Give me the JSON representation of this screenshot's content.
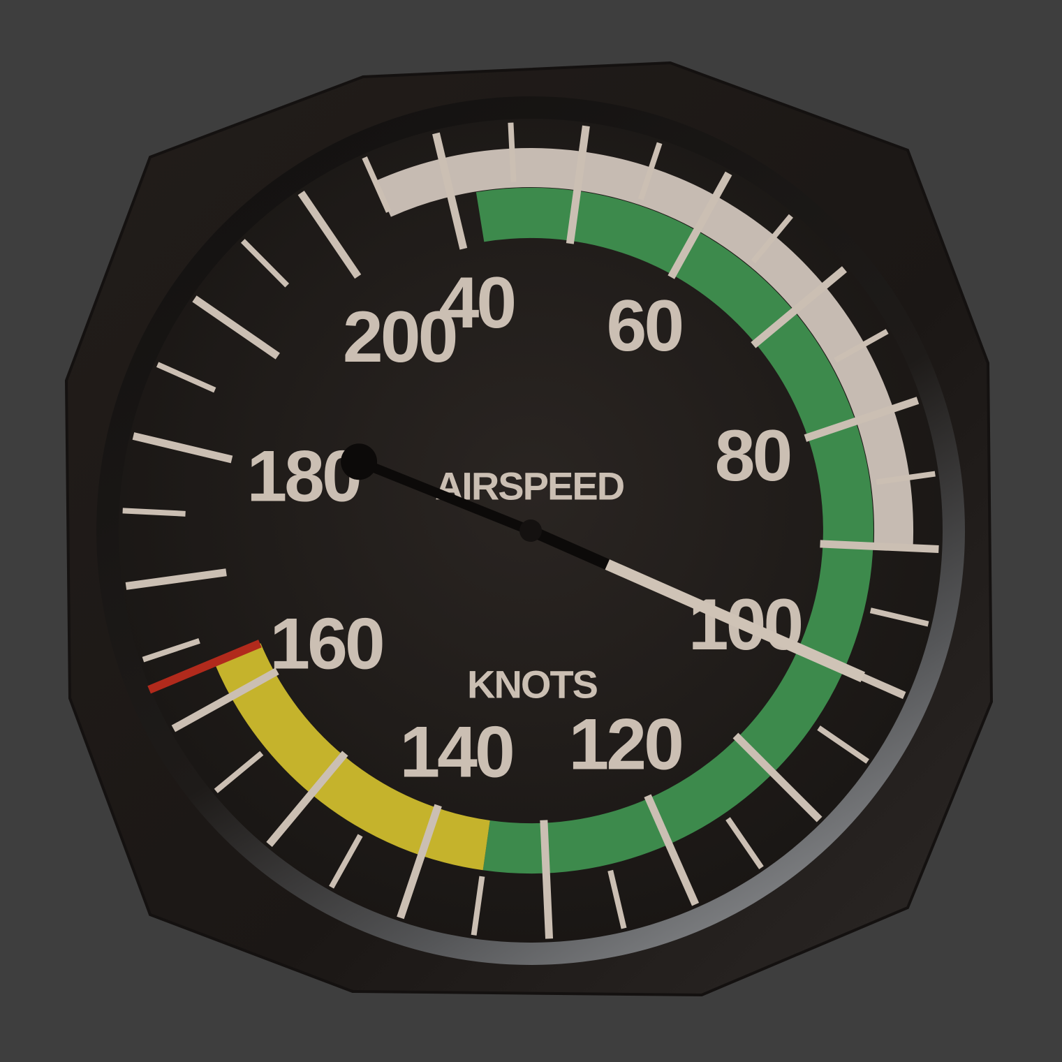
{
  "instrument": {
    "type": "airspeed-indicator",
    "title": "AIRSPEED",
    "unit": "KNOTS",
    "needle_value_knots": 100,
    "scale": {
      "labels": [
        "40",
        "60",
        "80",
        "100",
        "120",
        "140",
        "160",
        "180",
        "200"
      ],
      "label_values": [
        40,
        60,
        80,
        100,
        120,
        140,
        160,
        180,
        200
      ],
      "minor_tick_step_knots": 5
    },
    "arcs": [
      {
        "name": "white-arc",
        "from": 35,
        "to": 90,
        "color": "#c6bbb2"
      },
      {
        "name": "green-arc",
        "from": 42,
        "to": 135,
        "color": "#3d8a4c"
      },
      {
        "name": "yellow-arc",
        "from": 135,
        "to": 163,
        "color": "#c5b32c"
      }
    ],
    "redline_knots": 163,
    "colors": {
      "dial_face": "#1f1b19",
      "bezel": "#1c1917",
      "markings": "#cbbfb3",
      "needle": "#cfc3b6",
      "redline": "#b12a1c",
      "background": "#3e3e3e"
    }
  }
}
